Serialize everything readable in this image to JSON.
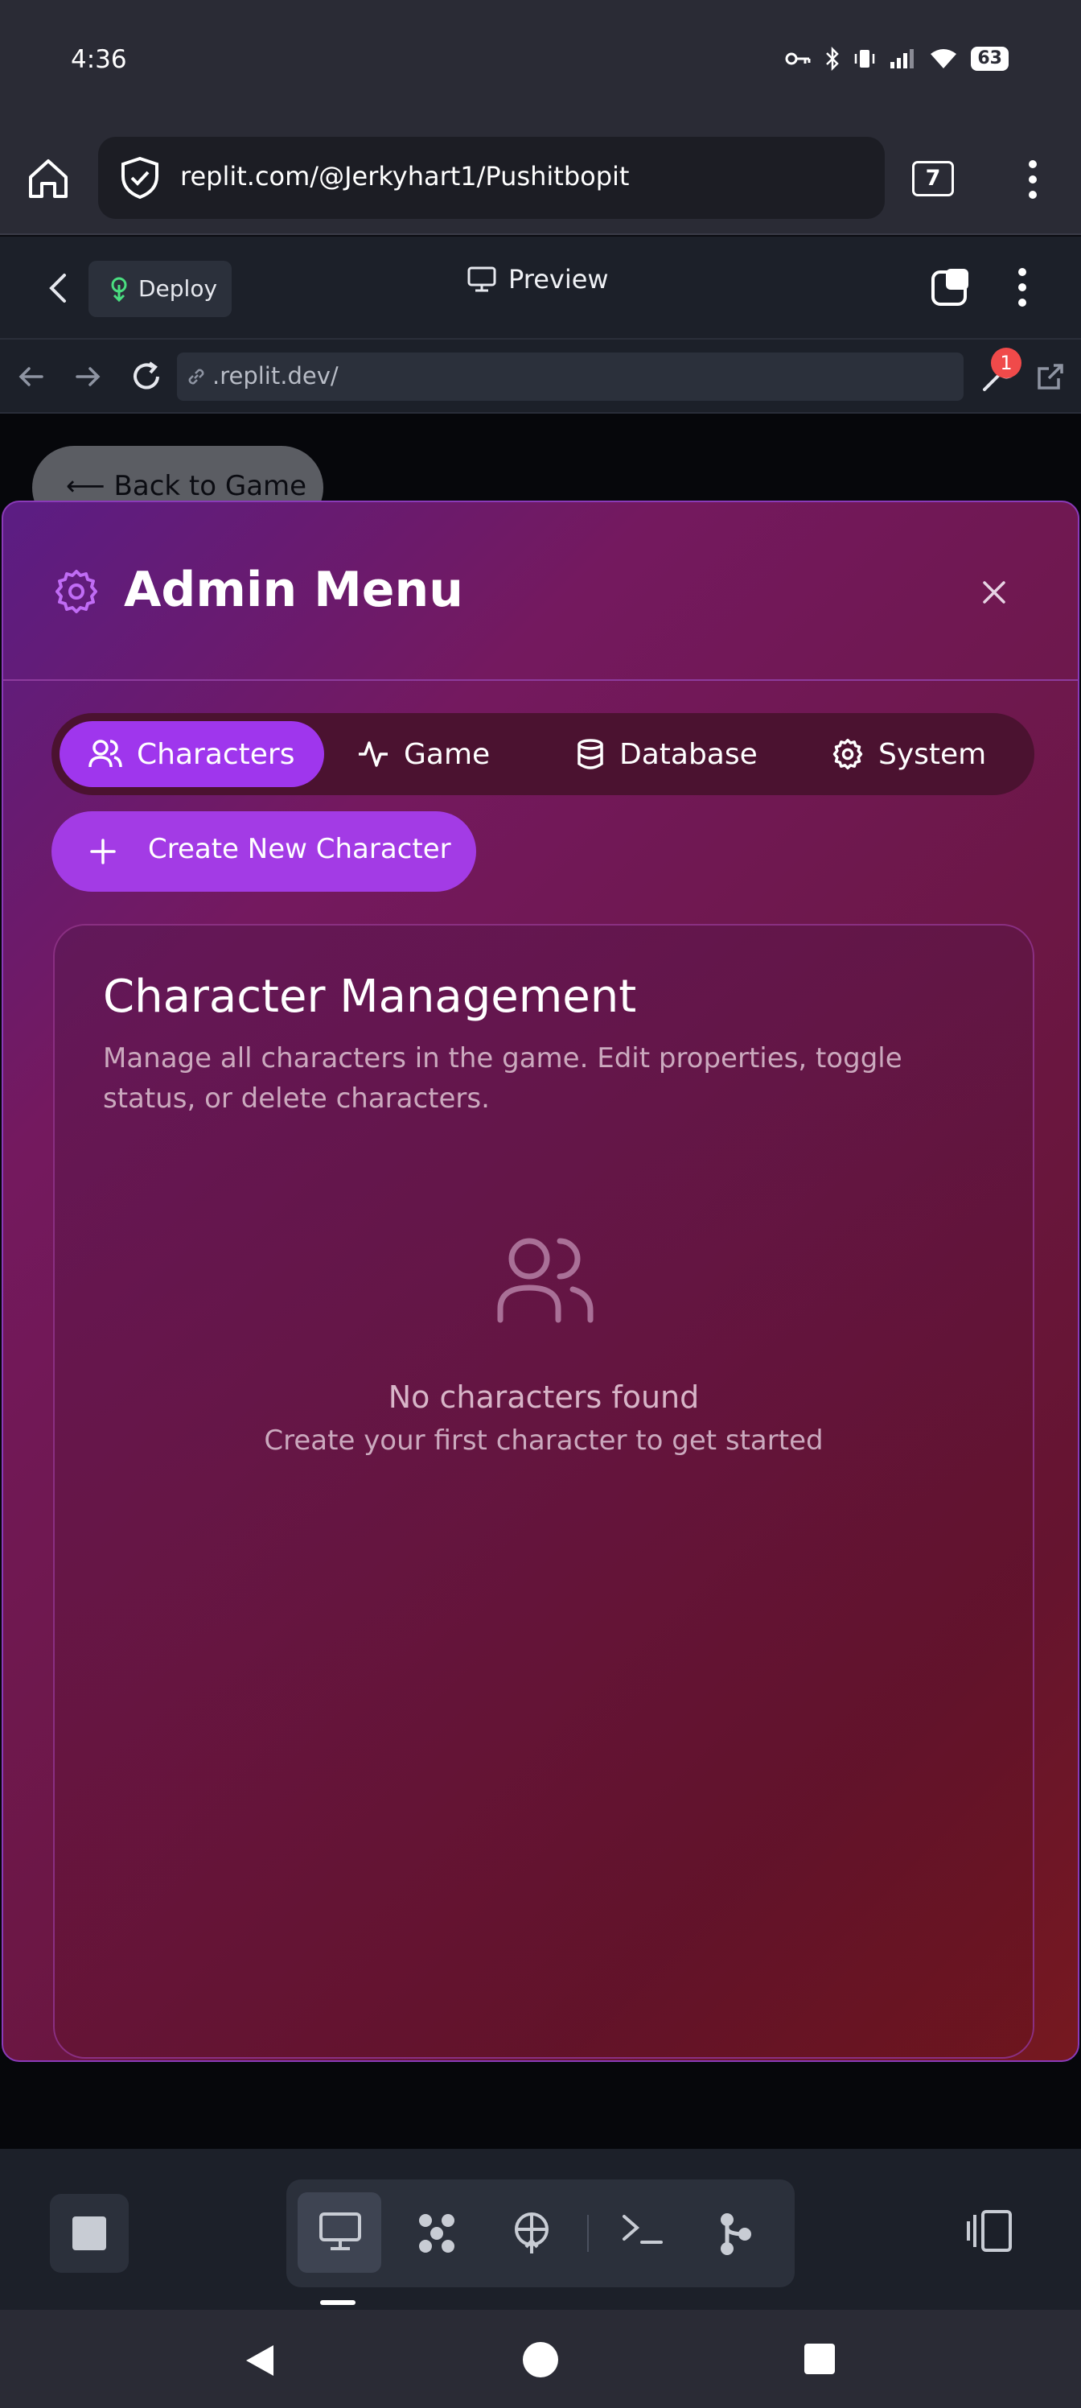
{
  "status_bar": {
    "time": "4:36",
    "battery": "63"
  },
  "browser": {
    "url": "replit.com/@Jerkyhart1/Pushitbopit",
    "tab_count": "7"
  },
  "replit_header": {
    "deploy_label": "Deploy",
    "preview_label": "Preview"
  },
  "webview": {
    "url": ".replit.dev/",
    "devtools_badge": "1"
  },
  "game": {
    "back_button": "⟵ Back to Game"
  },
  "admin_menu": {
    "title": "Admin Menu",
    "tabs": [
      {
        "label": "Characters",
        "icon": "users-icon",
        "active": true
      },
      {
        "label": "Game",
        "icon": "activity-icon",
        "active": false
      },
      {
        "label": "Database",
        "icon": "database-icon",
        "active": false
      },
      {
        "label": "System",
        "icon": "gear-icon",
        "active": false
      }
    ],
    "create_button": "Create New Character",
    "card": {
      "title": "Character Management",
      "description": "Manage all characters in the game. Edit properties, toggle status, or delete characters.",
      "empty_title": "No characters found",
      "empty_subtitle": "Create your first character to get started"
    }
  },
  "colors": {
    "accent": "#a33be5",
    "active_tab": "#9f36ed",
    "modal_border": "#8a3ab8"
  }
}
